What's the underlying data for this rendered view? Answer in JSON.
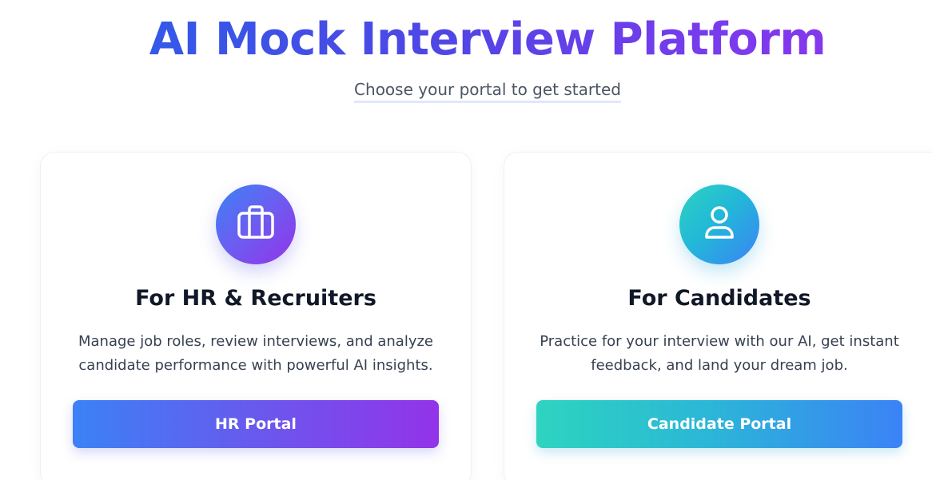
{
  "header": {
    "title": "AI Mock Interview Platform",
    "subtitle": "Choose your portal to get started"
  },
  "portals": [
    {
      "icon": "briefcase-icon",
      "heading": "For HR & Recruiters",
      "description": "Manage job roles, review interviews, and analyze candidate performance with powerful AI insights.",
      "button_label": "HR Portal"
    },
    {
      "icon": "user-icon",
      "heading": "For Candidates",
      "description": "Practice for your interview with our AI, get instant feedback, and land your dream job.",
      "button_label": "Candidate Portal"
    }
  ],
  "colors": {
    "title_gradient_start": "#2563eb",
    "title_gradient_end": "#9333ea",
    "hr_gradient_start": "#3b82f6",
    "hr_gradient_end": "#9333ea",
    "candidate_gradient_start": "#2dd4bf",
    "candidate_gradient_end": "#3b82f6"
  }
}
